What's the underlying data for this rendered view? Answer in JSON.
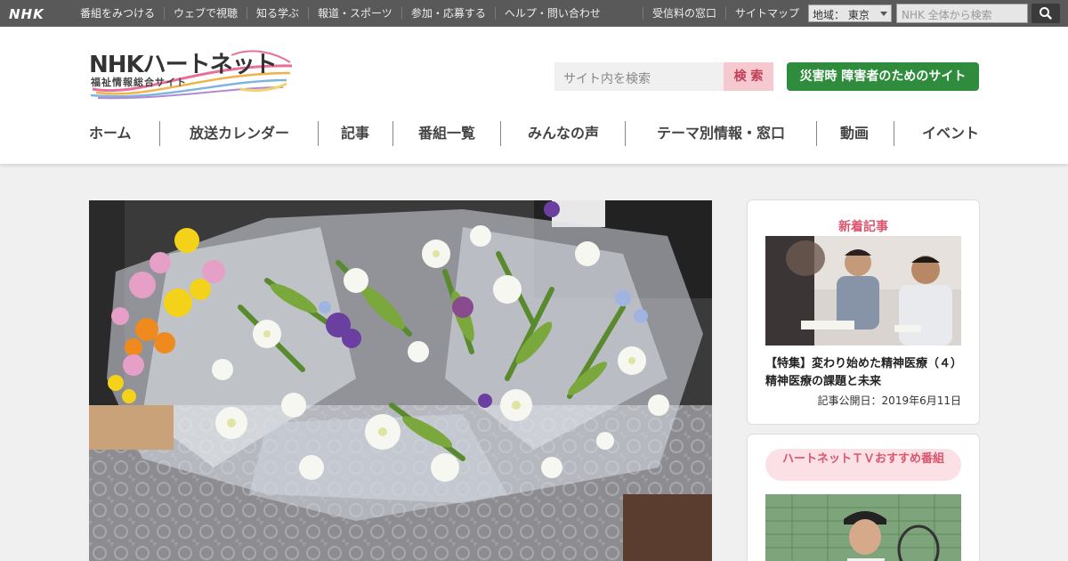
{
  "topbar": {
    "logo": "NHK",
    "links": [
      "番組をみつける",
      "ウェブで視聴",
      "知る学ぶ",
      "報道・スポーツ",
      "参加・応募する",
      "ヘルプ・問い合わせ"
    ],
    "right_links": [
      "受信料の窓口",
      "サイトマップ"
    ],
    "region_label": "地域：",
    "region_value": "東京",
    "search_placeholder": "NHK 全体から検索"
  },
  "header": {
    "logo_main": "NHKハートネット",
    "logo_sub": "福祉情報総合サイト",
    "site_search_placeholder": "サイト内を検索",
    "site_search_button": "検 索",
    "disaster_button": "災害時 障害者のためのサイト"
  },
  "nav": {
    "items": [
      "ホーム",
      "放送カレンダー",
      "記事",
      "番組一覧",
      "みんなの声",
      "テーマ別情報・窓口",
      "動画",
      "イベント"
    ]
  },
  "sidebar": {
    "new_articles": {
      "title": "新着記事",
      "article_title": "【特集】変わり始めた精神医療（４）精神医療の課題と未来",
      "article_date": "記事公開日：2019年6月11日"
    },
    "recommend": {
      "title": "ハートネットＴＶおすすめ番組"
    }
  },
  "colors": {
    "topbar_bg": "#595959",
    "accent_pink": "#d9566e",
    "search_btn_bg": "#f6c9d0",
    "disaster_green": "#2e8c3c",
    "page_bg": "#f0f0f0"
  }
}
